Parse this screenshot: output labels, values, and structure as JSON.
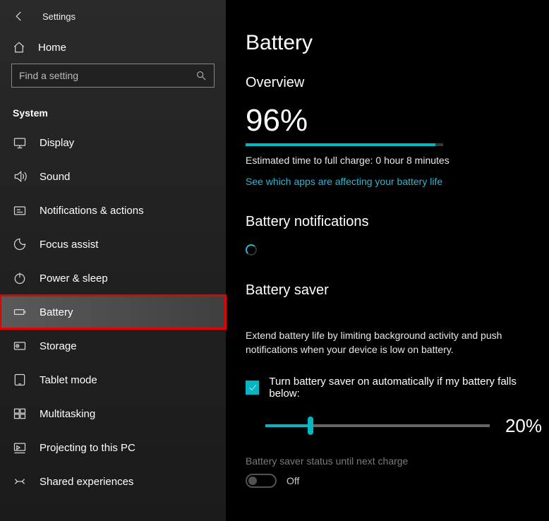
{
  "app_title": "Settings",
  "home_label": "Home",
  "search_placeholder": "Find a setting",
  "section_label": "System",
  "sidebar": {
    "items": [
      {
        "key": "display",
        "label": "Display"
      },
      {
        "key": "sound",
        "label": "Sound"
      },
      {
        "key": "notifications",
        "label": "Notifications & actions"
      },
      {
        "key": "focus-assist",
        "label": "Focus assist"
      },
      {
        "key": "power-sleep",
        "label": "Power & sleep"
      },
      {
        "key": "battery",
        "label": "Battery"
      },
      {
        "key": "storage",
        "label": "Storage"
      },
      {
        "key": "tablet-mode",
        "label": "Tablet mode"
      },
      {
        "key": "multitasking",
        "label": "Multitasking"
      },
      {
        "key": "projecting",
        "label": "Projecting to this PC"
      },
      {
        "key": "shared-experiences",
        "label": "Shared experiences"
      }
    ],
    "selected": "battery",
    "highlighted": "battery"
  },
  "main": {
    "page_title": "Battery",
    "overview": {
      "heading": "Overview",
      "percent_text": "96%",
      "percent_value": 96,
      "estimated": "Estimated time to full charge: 0 hour 8 minutes",
      "apps_link": "See which apps are affecting your battery life"
    },
    "notifications": {
      "heading": "Battery notifications"
    },
    "saver": {
      "heading": "Battery saver",
      "description": "Extend battery life by limiting background activity and push notifications when your device is low on battery.",
      "checkbox_label": "Turn battery saver on automatically if my battery falls below:",
      "checkbox_checked": true,
      "slider_value": 20,
      "slider_text": "20%",
      "status_label": "Battery saver status until next charge",
      "toggle_on": false,
      "toggle_text": "Off"
    }
  },
  "colors": {
    "accent": "#00b7c3",
    "link": "#2bb7d6"
  }
}
